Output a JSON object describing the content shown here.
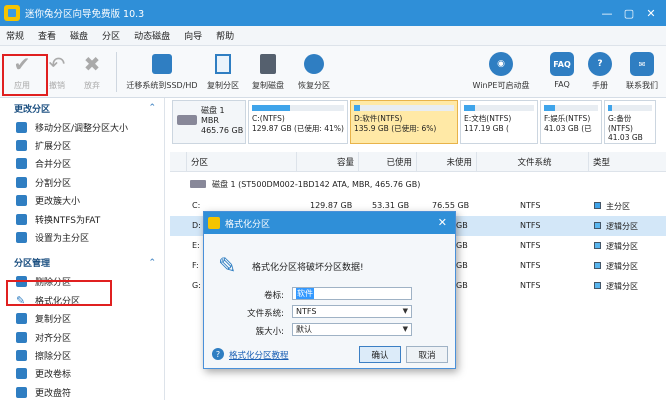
{
  "window": {
    "title": "迷你兔分区向导免费版 10.3",
    "minimize": "—",
    "maximize": "▢",
    "close": "✕"
  },
  "menu": [
    "常规",
    "查看",
    "磁盘",
    "分区",
    "动态磁盘",
    "向导",
    "帮助"
  ],
  "toolbar": {
    "apply": "应用",
    "undo": "撤销",
    "discard": "放弃",
    "migrate": "迁移系统到SSD/HD",
    "copy_part": "复制分区",
    "copy_disk": "复制磁盘",
    "recover": "恢复分区",
    "winpe": "WinPE可启动盘",
    "faq": "FAQ",
    "manual": "手册",
    "contact": "联系我们",
    "faq_icon": "FAQ"
  },
  "sidebar": {
    "sec1": "更改分区",
    "items1": [
      "移动分区/调整分区大小",
      "扩展分区",
      "合并分区",
      "分割分区",
      "更改簇大小",
      "转换NTFS为FAT",
      "设置为主分区"
    ],
    "sec2": "分区管理",
    "items2": [
      "删除分区",
      "格式化分区",
      "复制分区",
      "对齐分区",
      "擦除分区",
      "更改卷标",
      "更改盘符"
    ]
  },
  "diskmap": {
    "disk": {
      "name": "磁盘 1",
      "type": "MBR",
      "size": "465.76 GB"
    },
    "parts": [
      {
        "line1": "C:(NTFS)",
        "line2": "129.87 GB (已使用: 41%)",
        "used": 0.41
      },
      {
        "line1": "D:软件(NTFS)",
        "line2": "135.9 GB (已使用: 6%)",
        "used": 0.06
      },
      {
        "line1": "E:文档(NTFS)",
        "line2": "117.19 GB (",
        "used": 0.15
      },
      {
        "line1": "F:娱乐(NTFS)",
        "line2": "41.03 GB (已",
        "used": 0.2
      },
      {
        "line1": "G:备份(NTFS)",
        "line2": "41.03 GB (已",
        "used": 0.1
      }
    ]
  },
  "table": {
    "headers": [
      "分区",
      "容量",
      "已使用",
      "未使用",
      "文件系统",
      "类型"
    ],
    "disk_row": "磁盘 1 (ST500DM002-1BD142 ATA, MBR, 465.76 GB)",
    "rows": [
      {
        "part": "C:",
        "cap": "129.87 GB",
        "used": "53.31 GB",
        "free": "76.55 GB",
        "fs": "NTFS",
        "type": "主分区"
      },
      {
        "part": "D:",
        "cap": "",
        "used": "",
        "free": "GB",
        "fs": "NTFS",
        "type": "逻辑分区"
      },
      {
        "part": "E:",
        "cap": "",
        "used": "",
        "free": "GB",
        "fs": "NTFS",
        "type": "逻辑分区"
      },
      {
        "part": "F:",
        "cap": "",
        "used": "",
        "free": "GB",
        "fs": "NTFS",
        "type": "逻辑分区"
      },
      {
        "part": "G:",
        "cap": "",
        "used": "",
        "free": "GB",
        "fs": "NTFS",
        "type": "逻辑分区"
      }
    ]
  },
  "dialog": {
    "title": "格式化分区",
    "message": "格式化分区将破坏分区数据!",
    "label_volume": "卷标:",
    "value_volume": "软件",
    "label_fs": "文件系统:",
    "value_fs": "NTFS",
    "label_cluster": "簇大小:",
    "value_cluster": "默认",
    "help": "格式化分区教程",
    "ok": "确认",
    "cancel": "取消",
    "close": "✕"
  },
  "colors": {
    "accent": "#2f8fd8",
    "selected": "#ffe9a6",
    "highlight": "#e02020"
  }
}
